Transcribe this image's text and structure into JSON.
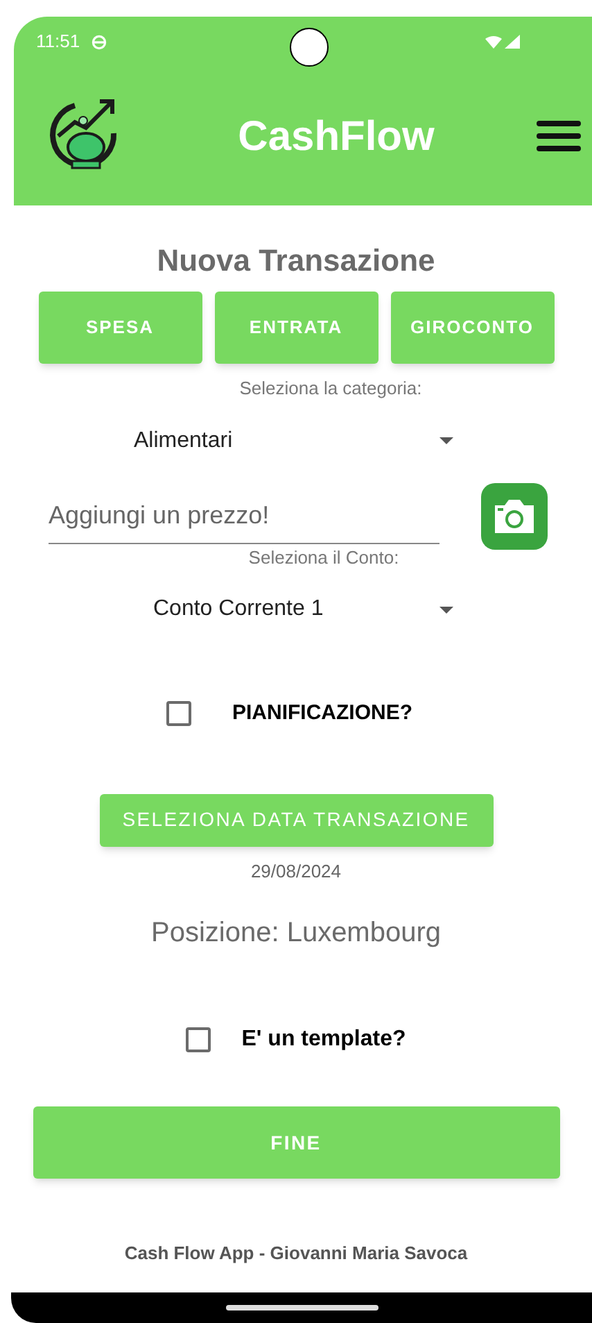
{
  "status_bar": {
    "time": "11:51"
  },
  "app_bar": {
    "title": "CashFlow"
  },
  "form": {
    "title": "Nuova Transazione",
    "type_buttons": [
      "SPESA",
      "ENTRATA",
      "GIROCONTO"
    ],
    "category_label": "Seleziona la categoria:",
    "category": "Alimentari",
    "price": {
      "placeholder": "Aggiungi un prezzo!"
    },
    "account_label": "Seleziona il Conto:",
    "account": "Conto Corrente 1",
    "planning": {
      "label": "PIANIFICAZIONE?",
      "checked": false
    },
    "date_button": "SELEZIONA DATA TRANSAZIONE",
    "date": "29/08/2024",
    "position": "Posizione: Luxembourg",
    "template": {
      "label": "E' un template?",
      "checked": false
    },
    "finish_button": "FINE"
  },
  "footer": "Cash Flow App - Giovanni Maria Savoca"
}
